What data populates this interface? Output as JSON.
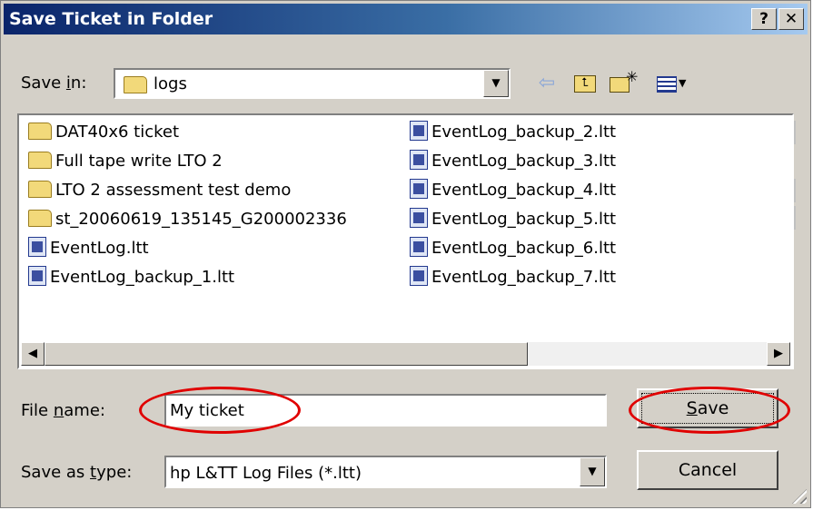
{
  "window": {
    "title": "Save Ticket in Folder",
    "help_label": "?",
    "close_label": "✕"
  },
  "save_in": {
    "label_pre": "Save ",
    "label_key": "i",
    "label_post": "n:",
    "value": "logs"
  },
  "toolbar": {
    "icons": [
      "back-arrow-icon",
      "up-one-level-icon",
      "new-folder-icon",
      "view-menu-icon"
    ]
  },
  "files": {
    "col1": [
      {
        "name": "DAT40x6 ticket",
        "type": "folder"
      },
      {
        "name": "Full tape write LTO 2",
        "type": "folder"
      },
      {
        "name": "LTO 2 assessment test demo",
        "type": "folder"
      },
      {
        "name": "st_20060619_135145_G200002336",
        "type": "folder"
      },
      {
        "name": "EventLog.ltt",
        "type": "file"
      },
      {
        "name": "EventLog_backup_1.ltt",
        "type": "file"
      }
    ],
    "col2": [
      {
        "name": "EventLog_backup_2.ltt",
        "type": "file"
      },
      {
        "name": "EventLog_backup_3.ltt",
        "type": "file"
      },
      {
        "name": "EventLog_backup_4.ltt",
        "type": "file"
      },
      {
        "name": "EventLog_backup_5.ltt",
        "type": "file"
      },
      {
        "name": "EventLog_backup_6.ltt",
        "type": "file"
      },
      {
        "name": "EventLog_backup_7.ltt",
        "type": "file"
      }
    ]
  },
  "file_name": {
    "label_pre": "File ",
    "label_key": "n",
    "label_post": "ame:",
    "value": "My ticket"
  },
  "save_as_type": {
    "label_pre": "Save as ",
    "label_key": "t",
    "label_post": "ype:",
    "value": "hp L&TT Log Files (*.ltt)"
  },
  "buttons": {
    "save_key": "S",
    "save_rest": "ave",
    "cancel": "Cancel"
  },
  "colors": {
    "title_bar": "#0a246a",
    "highlight_ellipse": "#e00000",
    "dialog_face": "#d4d0c8"
  }
}
